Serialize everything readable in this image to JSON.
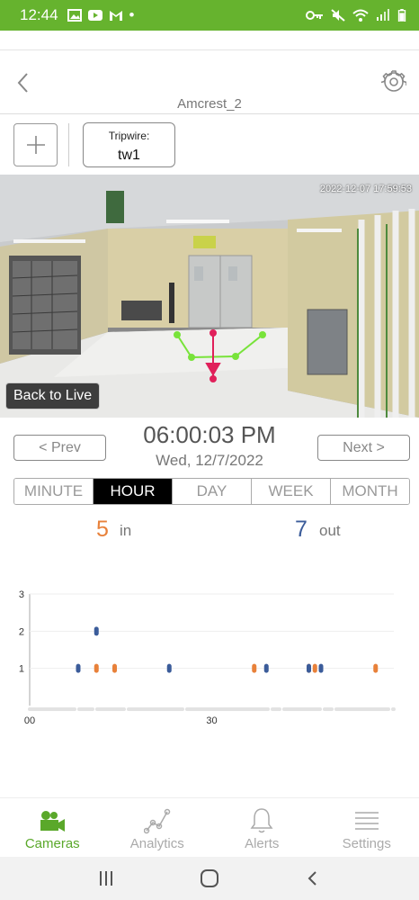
{
  "status_bar": {
    "time": "12:44",
    "bullet": "•",
    "colors": {
      "background": "#66b32e"
    }
  },
  "header": {
    "camera_name": "Amcrest_2",
    "back_icon": "chevron-left-icon",
    "settings_icon": "gear-icon"
  },
  "tripwire": {
    "add_icon": "plus-icon",
    "label": "Tripwire:",
    "value": "tw1"
  },
  "video": {
    "timestamp": "2022-12-07 17:59:53",
    "back_to_live_label": "Back to Live"
  },
  "time_nav": {
    "prev_label": "< Prev",
    "next_label": "Next >",
    "time": "06:00:03 PM",
    "date": "Wed, 12/7/2022"
  },
  "period_tabs": [
    {
      "label": "MINUTE",
      "active": false
    },
    {
      "label": "HOUR",
      "active": true
    },
    {
      "label": "DAY",
      "active": false
    },
    {
      "label": "WEEK",
      "active": false
    },
    {
      "label": "MONTH",
      "active": false
    }
  ],
  "counts": {
    "in_value": "5",
    "in_label": "in",
    "out_value": "7",
    "out_label": "out",
    "colors": {
      "in": "#e8813a",
      "out": "#3b5c9a"
    }
  },
  "chart_data": {
    "type": "scatter",
    "x_tick_labels": [
      "00",
      "30"
    ],
    "y_tick_labels": [
      "1",
      "2",
      "3"
    ],
    "xlim": [
      0,
      60
    ],
    "ylim": [
      0,
      3
    ],
    "series": [
      {
        "color": "#e8813a",
        "points": [
          [
            11,
            1
          ],
          [
            14,
            1
          ],
          [
            37,
            1
          ],
          [
            46,
            1
          ],
          [
            47,
            1
          ],
          [
            57,
            1
          ]
        ]
      },
      {
        "color": "#3b5c9a",
        "points": [
          [
            8,
            1
          ],
          [
            11,
            2
          ],
          [
            23,
            1
          ],
          [
            39,
            1
          ],
          [
            46,
            1
          ],
          [
            48,
            1
          ]
        ]
      }
    ]
  },
  "bottom_nav": [
    {
      "label": "Cameras",
      "icon": "video-camera-icon",
      "active": true
    },
    {
      "label": "Analytics",
      "icon": "analytics-chart-icon",
      "active": false
    },
    {
      "label": "Alerts",
      "icon": "bell-icon",
      "active": false
    },
    {
      "label": "Settings",
      "icon": "menu-lines-icon",
      "active": false
    }
  ],
  "system_nav": {
    "recents_icon": "recents-icon",
    "home_icon": "home-icon",
    "back_icon": "back-icon"
  }
}
